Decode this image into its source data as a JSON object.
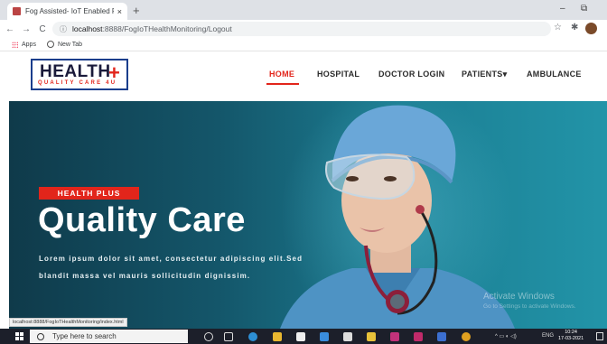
{
  "browser": {
    "tab_title": "Fog Assisted- IoT Enabled Patien",
    "tab_close": "×",
    "new_tab": "+",
    "url_host": "localhost",
    "url_path": ":8888/FogIoTHealthMonitoring/Logout",
    "bookmarks": [
      "Apps",
      "New Tab"
    ],
    "status_url": "localhost:8888/FogIoTHealthMonitoring/index.html",
    "window_controls": [
      "–",
      "⧉"
    ]
  },
  "site": {
    "logo_main": "HEALTH",
    "logo_plus": "+",
    "logo_sub": "QUALITY CARE 4U",
    "menu": {
      "home": "HOME",
      "hospital": "HOSPITAL",
      "doctor_login": "DOCTOR LOGIN",
      "patients": "PATIENTS",
      "patients_caret": "▾",
      "ambulance": "AMBULANCE"
    }
  },
  "hero": {
    "badge": "HEALTH PLUS",
    "title": "Quality Care",
    "line1": "Lorem ipsum dolor sit amet, consectetur adipiscing elit.Sed",
    "line2": "blandit massa vel mauris sollicitudin dignissim."
  },
  "watermark": {
    "title": "Activate Windows",
    "sub": "Go to Settings to activate Windows."
  },
  "taskbar": {
    "search_placeholder": "Type here to search",
    "tray_text": "ENG",
    "time": "10:24",
    "date": "17-03-2021"
  },
  "colors": {
    "accent_red": "#e2251b",
    "hero_teal": "#14566a",
    "logo_border": "#1a3e8c"
  }
}
